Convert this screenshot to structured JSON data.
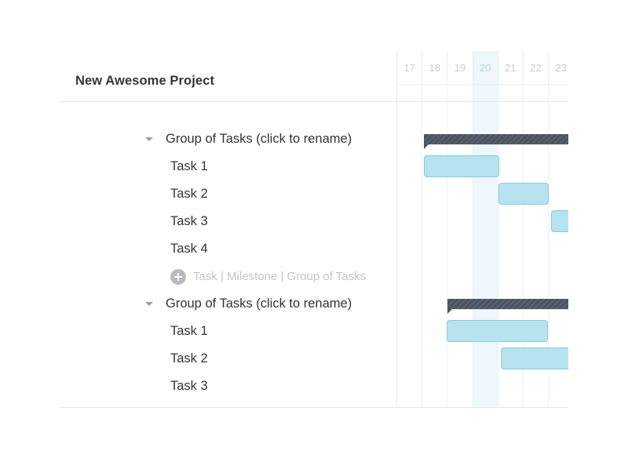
{
  "app": {
    "background": "#ffffff",
    "card_background": "#ffffff"
  },
  "header": {
    "project_title": "New Awesome Project"
  },
  "colors": {
    "task_bar_fill": "#b6e3ef",
    "task_bar_border": "#8bcbdd",
    "group_bar": "#4c5360",
    "today_column": "#eef7fb",
    "grid_line": "#f0f0f0",
    "text_primary": "#32353a",
    "text_muted": "#c2c6c9",
    "add_icon_bg": "#b9bcbe"
  },
  "timeline": {
    "day_headers": [
      "17",
      "18",
      "19",
      "20",
      "21",
      "22",
      "23"
    ],
    "highlighted_day": "20",
    "col_width": 32.2,
    "start_offset": 0
  },
  "rows": [
    {
      "type": "group",
      "label": "Group of Tasks (click to rename)",
      "caret_icon": "chevron-down-icon",
      "expanded": true,
      "bar": {
        "kind": "group",
        "start_day": 18.05,
        "end_day": 23.9
      }
    },
    {
      "type": "task",
      "label": "Task 1",
      "bar": {
        "kind": "task",
        "start_day": 18.05,
        "end_day": 21.05
      }
    },
    {
      "type": "task",
      "label": "Task 2",
      "bar": {
        "kind": "task",
        "start_day": 21.0,
        "end_day": 23.0
      }
    },
    {
      "type": "task",
      "label": "Task 3",
      "bar": {
        "kind": "task",
        "start_day": 23.1,
        "end_day": 24.0
      }
    },
    {
      "type": "task",
      "label": "Task 4",
      "bar": null
    },
    {
      "type": "add",
      "icon": "plus-circle-icon",
      "links": "Task | Milestone | Group of Tasks"
    },
    {
      "type": "group",
      "label": "Group of Tasks (click to rename)",
      "caret_icon": "chevron-down-icon",
      "expanded": true,
      "bar": {
        "kind": "group",
        "start_day": 19.0,
        "end_day": 24.0
      }
    },
    {
      "type": "task",
      "label": "Task 1",
      "bar": {
        "kind": "task",
        "start_day": 18.95,
        "end_day": 22.95
      }
    },
    {
      "type": "task",
      "label": "Task 2",
      "bar": {
        "kind": "task",
        "start_day": 21.1,
        "end_day": 24.0
      }
    },
    {
      "type": "task",
      "label": "Task 3",
      "bar": null
    }
  ]
}
